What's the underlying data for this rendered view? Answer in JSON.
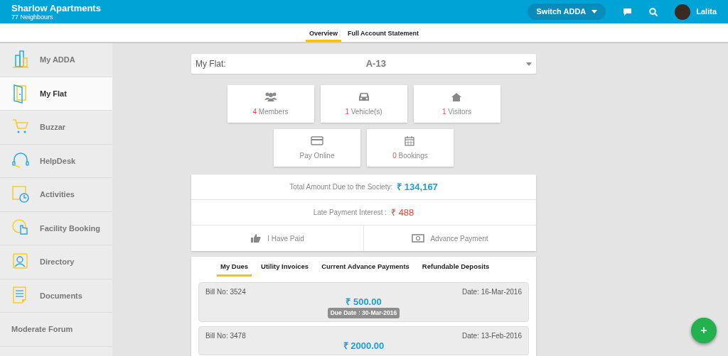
{
  "header": {
    "title": "Sharlow Apartments",
    "subtitle": "77 Neighbours",
    "switch_button": "Switch ADDA",
    "user": "Lalita"
  },
  "subnav": [
    {
      "label": "Overview",
      "selected": true
    },
    {
      "label": "Full Account Statement",
      "selected": false
    }
  ],
  "sidebar": {
    "items": [
      {
        "label": "My ADDA",
        "kind": "building",
        "selected": false
      },
      {
        "label": "My Flat",
        "kind": "door",
        "selected": true
      },
      {
        "label": "Buzzar",
        "kind": "cart",
        "selected": false
      },
      {
        "label": "HelpDesk",
        "kind": "headset",
        "selected": false
      },
      {
        "label": "Activities",
        "kind": "calendar",
        "selected": false
      },
      {
        "label": "Facility Booking",
        "kind": "hand",
        "selected": false
      },
      {
        "label": "Directory",
        "kind": "contact",
        "selected": false
      },
      {
        "label": "Documents",
        "kind": "document",
        "selected": false
      },
      {
        "label": "Moderate Forum",
        "kind": "plain",
        "selected": false
      }
    ]
  },
  "flat_selector": {
    "label": "My Flat:",
    "value": "A-13"
  },
  "tiles": [
    {
      "kind": "members",
      "count": "4",
      "label": "Members"
    },
    {
      "kind": "vehicle",
      "count": "1",
      "label": "Vehicle(s)"
    },
    {
      "kind": "visitors",
      "count": "1",
      "label": "Visitors"
    },
    {
      "kind": "pay",
      "label": "Pay Online"
    },
    {
      "kind": "bookings",
      "count": "0",
      "label": "Bookings"
    }
  ],
  "summary": {
    "total_label": "Total Amount Due to the Society:",
    "total_value": "₹ 134,167",
    "interest_label": "Late Payment Interest :",
    "interest_value": "₹ 488",
    "actions": [
      {
        "kind": "thumb",
        "label": "I Have Paid"
      },
      {
        "kind": "money",
        "label": "Advance Payment"
      }
    ]
  },
  "dues_tabs": [
    {
      "label": "My Dues",
      "selected": true
    },
    {
      "label": "Utility Invoices",
      "selected": false
    },
    {
      "label": "Current Advance Payments",
      "selected": false
    },
    {
      "label": "Refundable Deposits",
      "selected": false
    }
  ],
  "bills": [
    {
      "bill_no": "Bill No: 3524",
      "date": "Date: 16-Mar-2016",
      "amount": "₹ 500.00",
      "due_date": "Due Date : 30-Mar-2016"
    },
    {
      "bill_no": "Bill No: 3478",
      "date": "Date: 13-Feb-2016",
      "amount": "₹ 2000.00"
    }
  ],
  "fab": "+"
}
